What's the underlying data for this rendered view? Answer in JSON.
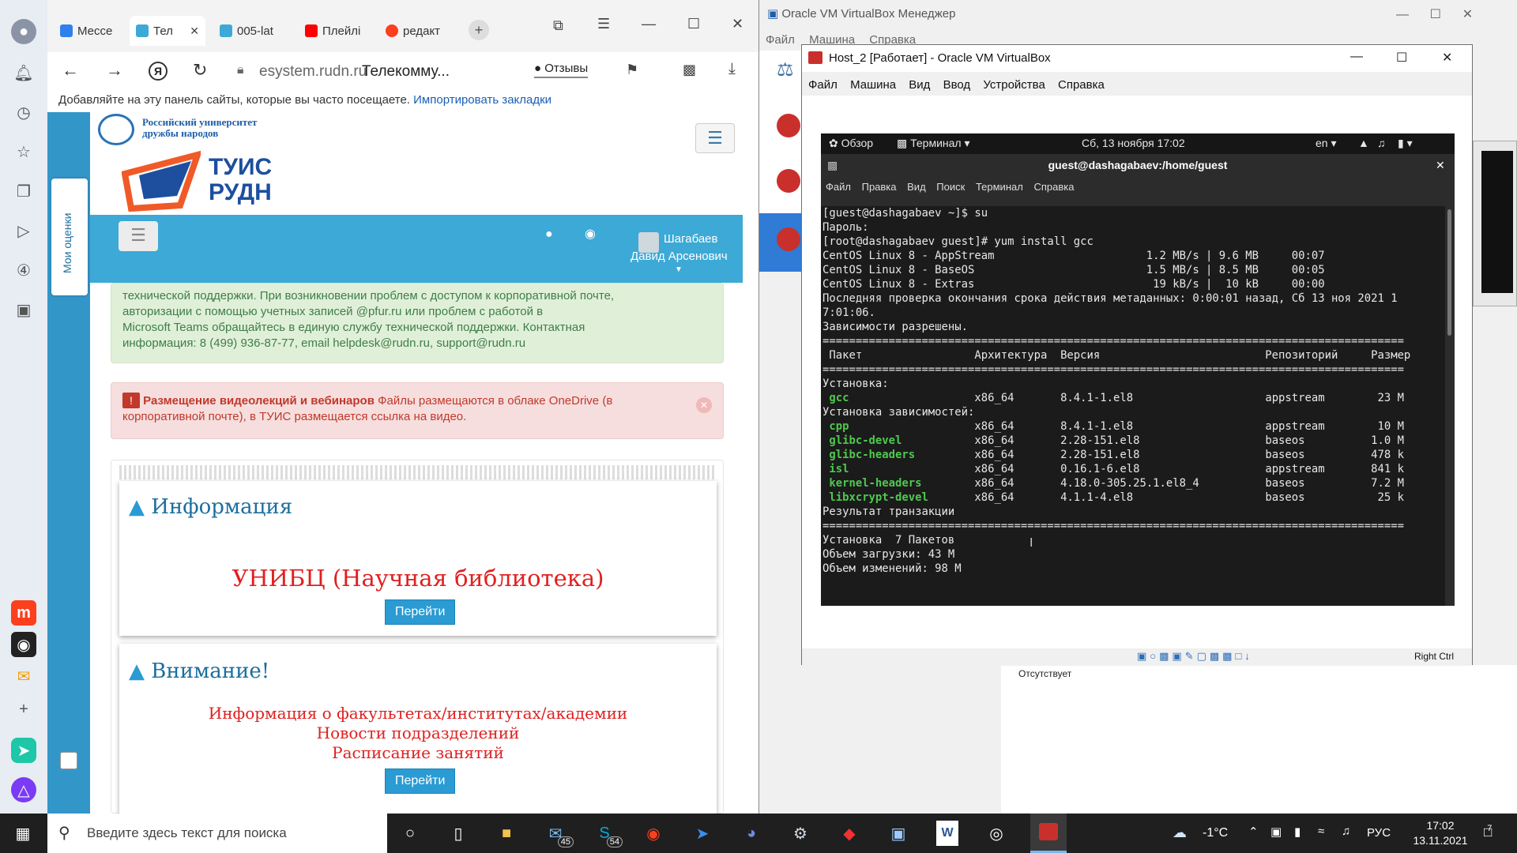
{
  "browser": {
    "tabs": [
      {
        "label": "Мессе",
        "color": "#2f80ed"
      },
      {
        "label": "Тел",
        "color": "#3da9d6"
      },
      {
        "label": "005-lat",
        "color": "#3da9d6"
      },
      {
        "label": "Плейлі",
        "color": "#ff0000"
      },
      {
        "label": "редакт",
        "color": "#fc3f1d"
      }
    ],
    "url_domain": "esystem.rudn.ru",
    "page_title": "Телекомму...",
    "reviews_label": "Отзывы",
    "bookmark_hint": "Добавляйте на эту панель сайты, которые вы часто посещаете.",
    "import_link": "Импортировать закладки",
    "side_tab": "Мои оценки"
  },
  "site": {
    "uni_name_1": "Российский университет",
    "uni_name_2": "дружбы народов",
    "brand_1": "ТУИС",
    "brand_2": "РУДН",
    "user_name_1": "Шагабаев",
    "user_name_2": "Давид Арсенович",
    "alert_green_lines": [
      "технической поддержки. При возникновении проблем с доступом к корпоративной почте,",
      "авторизации с помощью учетных записей @pfur.ru или проблем с работой в",
      "Microsoft Teams обращайтесь в единую службу технической поддержки. Контактная",
      "информация: 8 (499) 936-87-77, email helpdesk@rudn.ru, support@rudn.ru"
    ],
    "alert_red_title": "Размещение видеолекций и вебинаров",
    "alert_red_text_1": "Файлы размещаются в облаке OneDrive (в",
    "alert_red_text_2": "корпоративной почте), в ТУИС размещается ссылка на видео.",
    "info_title": "Информация",
    "info_link": "УНИБЦ (Научная библиотека)",
    "go_label": "Перейти",
    "attention_title": "Внимание!",
    "attention_links": [
      "Информация о факультетах/институтах/академии",
      "Новости подразделений",
      "Расписание занятий"
    ]
  },
  "vbox": {
    "manager_title": "Oracle VM VirtualBox Менеджер",
    "manager_menu": [
      "Файл",
      "Машина",
      "Справка"
    ],
    "vm_title": "Host_2 [Работает] - Oracle VM VirtualBox",
    "vm_menu": [
      "Файл",
      "Машина",
      "Вид",
      "Ввод",
      "Устройства",
      "Справка"
    ],
    "host_key": "Right Ctrl",
    "absent_label": "Отсутствует"
  },
  "guest": {
    "overview": "Обзор",
    "terminal_app": "Терминал",
    "clock": "Сб, 13 ноября  17:02",
    "lang": "en",
    "term_title": "guest@dashagabaev:/home/guest",
    "term_menu": [
      "Файл",
      "Правка",
      "Вид",
      "Поиск",
      "Терминал",
      "Справка"
    ],
    "lines": [
      {
        "t": "[guest@dashagabaev ~]$ su"
      },
      {
        "t": "Пароль:"
      },
      {
        "t": "[root@dashagabaev guest]# yum install gcc"
      },
      {
        "t": "CentOS Linux 8 - AppStream                       1.2 MB/s | 9.6 MB     00:07"
      },
      {
        "t": "CentOS Linux 8 - BaseOS                          1.5 MB/s | 8.5 MB     00:05"
      },
      {
        "t": "CentOS Linux 8 - Extras                           19 kB/s |  10 kB     00:00"
      },
      {
        "t": "Последняя проверка окончания срока действия метаданных: 0:00:01 назад, Сб 13 ноя 2021 1"
      },
      {
        "t": "7:01:06."
      },
      {
        "t": "Зависимости разрешены."
      },
      {
        "t": "========================================================================================"
      },
      {
        "t": " Пакет                 Архитектура  Версия                         Репозиторий     Размер"
      },
      {
        "t": "========================================================================================"
      },
      {
        "t": "Установка:"
      },
      {
        "p": "gcc",
        "t": "                   x86_64       8.4.1-1.el8                    appstream        23 M"
      },
      {
        "t": "Установка зависимостей:"
      },
      {
        "p": "cpp",
        "t": "                   x86_64       8.4.1-1.el8                    appstream        10 M"
      },
      {
        "p": "glibc-devel",
        "t": "           x86_64       2.28-151.el8                   baseos          1.0 M"
      },
      {
        "p": "glibc-headers",
        "t": "         x86_64       2.28-151.el8                   baseos          478 k"
      },
      {
        "p": "isl",
        "t": "                   x86_64       0.16.1-6.el8                   appstream       841 k"
      },
      {
        "p": "kernel-headers",
        "t": "        x86_64       4.18.0-305.25.1.el8_4          baseos          7.2 M"
      },
      {
        "p": "libxcrypt-devel",
        "t": "       x86_64       4.1.1-4.el8                    baseos           25 k"
      },
      {
        "t": ""
      },
      {
        "t": "Результат транзакции"
      },
      {
        "t": "========================================================================================"
      },
      {
        "t": "Установка  7 Пакетов"
      },
      {
        "t": ""
      },
      {
        "t": "Объем загрузки: 43 M"
      },
      {
        "t": "Объем изменений: 98 M"
      }
    ]
  },
  "taskbar": {
    "search_placeholder": "Введите здесь текст для поиска",
    "mail_badge": "45",
    "skype_badge": "54",
    "temperature": "-1°C",
    "lang": "РУС",
    "time": "17:02",
    "date": "13.11.2021",
    "notif_count": "7"
  }
}
